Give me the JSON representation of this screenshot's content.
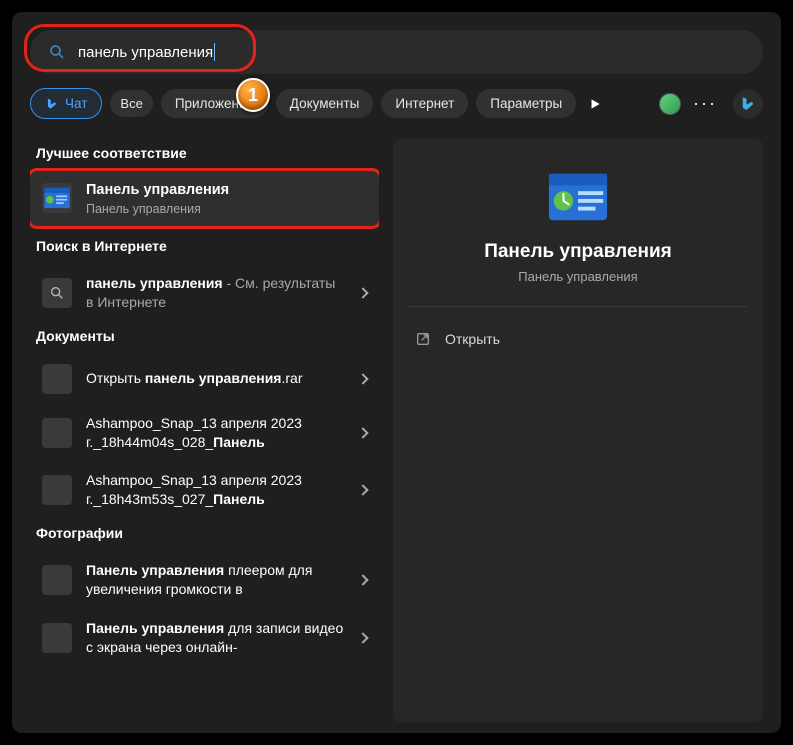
{
  "search": {
    "query": "панель управления"
  },
  "filters": {
    "chat": "Чат",
    "all": "Все",
    "apps": "Приложения",
    "documents": "Документы",
    "internet": "Интернет",
    "settings": "Параметры"
  },
  "sections": {
    "best_match": "Лучшее соответствие",
    "web_search": "Поиск в Интернете",
    "documents": "Документы",
    "photos": "Фотографии"
  },
  "best": {
    "title": "Панель управления",
    "subtitle": "Панель управления"
  },
  "web": {
    "query_bold": "панель управления",
    "suffix": " - См. результаты в Интернете"
  },
  "docs": [
    {
      "pre": "Открыть ",
      "bold": "панель управления",
      "post": ".rar"
    },
    {
      "pre": "Ashampoo_Snap_13 апреля 2023 г._18h44m04s_028_",
      "bold": "Панель",
      "post": ""
    },
    {
      "pre": "Ashampoo_Snap_13 апреля 2023 г._18h43m53s_027_",
      "bold": "Панель",
      "post": ""
    }
  ],
  "photos": [
    {
      "bold": "Панель управления",
      "post": " плеером для увеличения громкости в"
    },
    {
      "bold": "Панель управления",
      "post": " для записи видео с экрана через онлайн-"
    }
  ],
  "preview": {
    "title": "Панель управления",
    "subtitle": "Панель управления",
    "open": "Открыть"
  },
  "marker": {
    "one": "1"
  }
}
